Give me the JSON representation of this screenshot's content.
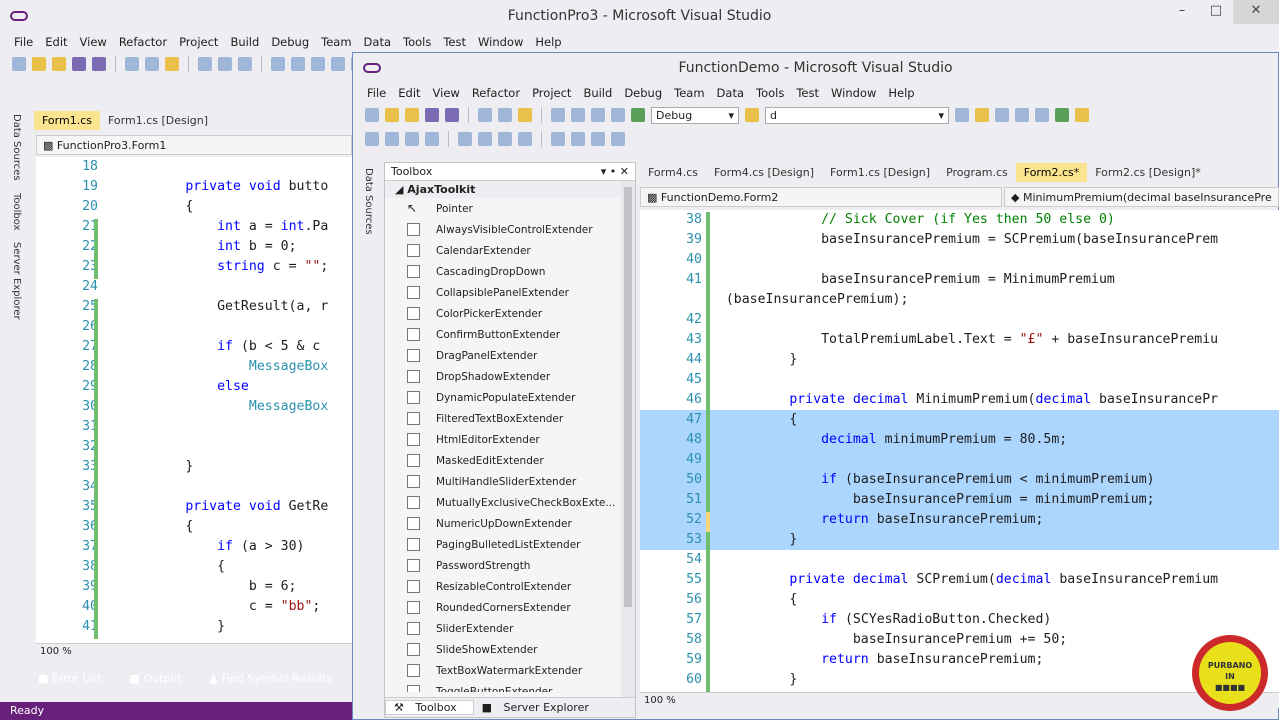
{
  "back_window": {
    "title": "FunctionPro3 - Microsoft Visual Studio",
    "menu": [
      "File",
      "Edit",
      "View",
      "Refactor",
      "Project",
      "Build",
      "Debug",
      "Team",
      "Data",
      "Tools",
      "Test",
      "Window",
      "Help"
    ],
    "side_tabs": [
      "Data Sources",
      "Toolbox",
      "Server Explorer"
    ],
    "doc_tabs": [
      "Form1.cs",
      "Form1.cs [Design]"
    ],
    "nav": "FunctionPro3.Form1",
    "zoom": "100 %",
    "bottom_tabs": [
      "Error List",
      "Output",
      "Find Symbol Results"
    ],
    "status": "Ready",
    "code": [
      {
        "n": "18",
        "t": ""
      },
      {
        "n": "19",
        "t": "        private void butto"
      },
      {
        "n": "20",
        "t": "        {"
      },
      {
        "n": "21",
        "t": "            int a = int.Pa"
      },
      {
        "n": "22",
        "t": "            int b = 0;"
      },
      {
        "n": "23",
        "t": "            string c = \"\";"
      },
      {
        "n": "24",
        "t": ""
      },
      {
        "n": "25",
        "t": "            GetResult(a, r"
      },
      {
        "n": "26",
        "t": ""
      },
      {
        "n": "27",
        "t": "            if (b < 5 & c"
      },
      {
        "n": "28",
        "t": "                MessageBox"
      },
      {
        "n": "29",
        "t": "            else"
      },
      {
        "n": "30",
        "t": "                MessageBox"
      },
      {
        "n": "31",
        "t": ""
      },
      {
        "n": "32",
        "t": ""
      },
      {
        "n": "33",
        "t": "        }"
      },
      {
        "n": "34",
        "t": ""
      },
      {
        "n": "35",
        "t": "        private void GetRe"
      },
      {
        "n": "36",
        "t": "        {"
      },
      {
        "n": "37",
        "t": "            if (a > 30)"
      },
      {
        "n": "38",
        "t": "            {"
      },
      {
        "n": "39",
        "t": "                b = 6;"
      },
      {
        "n": "40",
        "t": "                c = \"bb\";"
      },
      {
        "n": "41",
        "t": "            }"
      }
    ]
  },
  "front_window": {
    "title": "FunctionDemo - Microsoft Visual Studio",
    "menu": [
      "File",
      "Edit",
      "View",
      "Refactor",
      "Project",
      "Build",
      "Debug",
      "Team",
      "Data",
      "Tools",
      "Test",
      "Window",
      "Help"
    ],
    "config": "Debug",
    "search": "d",
    "side_tab": "Data Sources",
    "toolbox": {
      "header": "Toolbox",
      "group": "◢ AjaxToolkit",
      "items": [
        "Pointer",
        "AlwaysVisibleControlExtender",
        "CalendarExtender",
        "CascadingDropDown",
        "CollapsiblePanelExtender",
        "ColorPickerExtender",
        "ConfirmButtonExtender",
        "DragPanelExtender",
        "DropShadowExtender",
        "DynamicPopulateExtender",
        "FilteredTextBoxExtender",
        "HtmlEditorExtender",
        "MaskedEditExtender",
        "MultiHandleSliderExtender",
        "MutuallyExclusiveCheckBoxExte...",
        "NumericUpDownExtender",
        "PagingBulletedListExtender",
        "PasswordStrength",
        "ResizableControlExtender",
        "RoundedCornersExtender",
        "SliderExtender",
        "SlideShowExtender",
        "TextBoxWatermarkExtender",
        "ToggleButtonExtender"
      ],
      "footer": [
        "Toolbox",
        "Server Explorer"
      ]
    },
    "doc_tabs": [
      "Form4.cs",
      "Form4.cs [Design]",
      "Form1.cs [Design]",
      "Program.cs",
      "Form2.cs*",
      "Form2.cs [Design]*"
    ],
    "nav_left": "FunctionDemo.Form2",
    "nav_right": "MinimumPremium(decimal baseInsurancePre",
    "zoom": "100 %",
    "code": [
      {
        "n": "38",
        "t": "            // Sick Cover (if Yes then 50 else 0)"
      },
      {
        "n": "39",
        "t": "            baseInsurancePremium = SCPremium(baseInsurancePrem"
      },
      {
        "n": "40",
        "t": ""
      },
      {
        "n": "41",
        "t": "            baseInsurancePremium = MinimumPremium"
      },
      {
        "n": "",
        "t": "(baseInsurancePremium);"
      },
      {
        "n": "42",
        "t": ""
      },
      {
        "n": "43",
        "t": "            TotalPremiumLabel.Text = \"£\" + baseInsurancePremiu"
      },
      {
        "n": "44",
        "t": "        }"
      },
      {
        "n": "45",
        "t": ""
      },
      {
        "n": "46",
        "t": "        private decimal MinimumPremium(decimal baseInsurancePr"
      },
      {
        "n": "47",
        "t": "        {"
      },
      {
        "n": "48",
        "t": "            decimal minimumPremium = 80.5m;"
      },
      {
        "n": "49",
        "t": ""
      },
      {
        "n": "50",
        "t": "            if (baseInsurancePremium < minimumPremium)"
      },
      {
        "n": "51",
        "t": "                baseInsurancePremium = minimumPremium;"
      },
      {
        "n": "52",
        "t": "            return baseInsurancePremium;"
      },
      {
        "n": "53",
        "t": "        }"
      },
      {
        "n": "54",
        "t": ""
      },
      {
        "n": "55",
        "t": "        private decimal SCPremium(decimal baseInsurancePremium"
      },
      {
        "n": "56",
        "t": "        {"
      },
      {
        "n": "57",
        "t": "            if (SCYesRadioButton.Checked)"
      },
      {
        "n": "58",
        "t": "                baseInsurancePremium += 50;"
      },
      {
        "n": "59",
        "t": "            return baseInsurancePremium;"
      },
      {
        "n": "60",
        "t": "        }"
      }
    ]
  },
  "badge": {
    "line1": "PURBANO",
    "line2": "IN",
    "line3": "■■■■"
  },
  "colors": {
    "accent": "#68217a",
    "selection": "#add6ff",
    "keyword": "#0000ff",
    "comment": "#008000",
    "string": "#a31515"
  }
}
